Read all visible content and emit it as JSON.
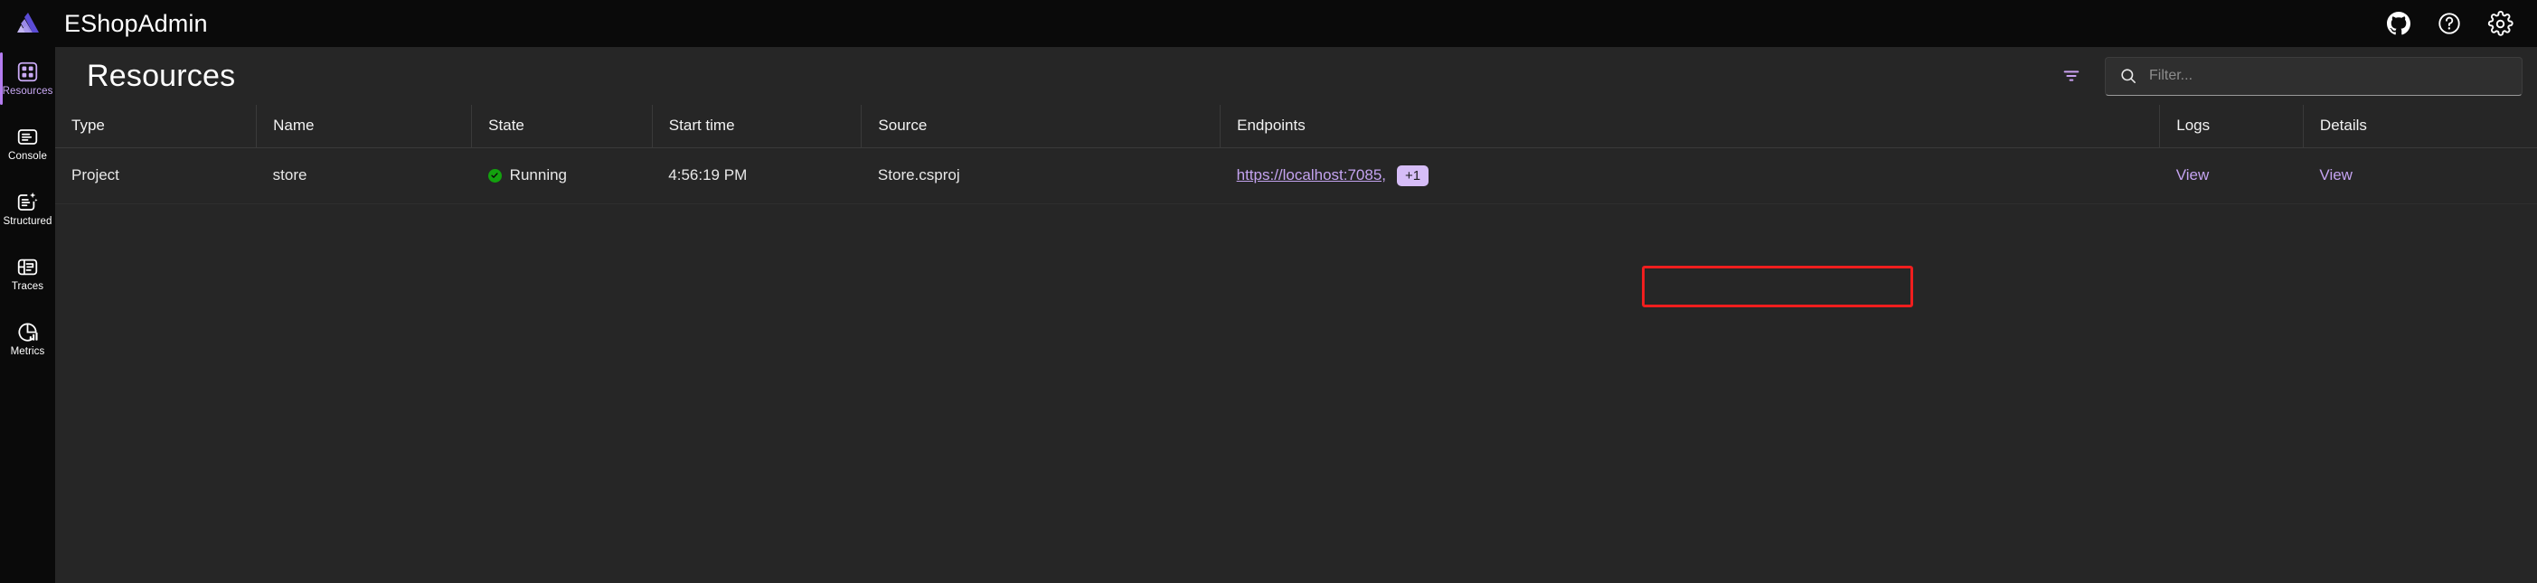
{
  "header": {
    "app_title": "EShopAdmin",
    "logo_icon": "aspire-logo-icon",
    "actions": [
      {
        "name": "github-icon",
        "label": "GitHub"
      },
      {
        "name": "help-icon",
        "label": "Help"
      },
      {
        "name": "settings-gear-icon",
        "label": "Settings"
      }
    ]
  },
  "sidebar": {
    "items": [
      {
        "label": "Resources",
        "icon": "resources-grid-icon",
        "active": true
      },
      {
        "label": "Console",
        "icon": "console-log-icon",
        "active": false
      },
      {
        "label": "Structured",
        "icon": "structured-logs-icon",
        "active": false
      },
      {
        "label": "Traces",
        "icon": "traces-icon",
        "active": false
      },
      {
        "label": "Metrics",
        "icon": "metrics-chart-icon",
        "active": false
      }
    ]
  },
  "page": {
    "title": "Resources",
    "filter_toggle_icon": "filter-icon",
    "search": {
      "icon": "search-icon",
      "placeholder": "Filter...",
      "value": ""
    }
  },
  "table": {
    "columns": [
      "Type",
      "Name",
      "State",
      "Start time",
      "Source",
      "Endpoints",
      "Logs",
      "Details"
    ],
    "rows": [
      {
        "type": "Project",
        "name": "store",
        "state": "Running",
        "state_icon": "checkmark-circle-icon",
        "start_time": "4:56:19 PM",
        "source": "Store.csproj",
        "endpoint_url": "https://localhost:7085,",
        "endpoint_more": "+1",
        "logs": "View",
        "details": "View"
      }
    ]
  },
  "annotation": {
    "color": "#f01e1e",
    "target": "endpoint-url-link"
  },
  "colors": {
    "accent": "#b47cf0",
    "link": "#c4a3f0",
    "running": "#13a10e",
    "badge_bg": "#d6bdf7",
    "header_bg": "#0a0a0a",
    "main_bg": "#262626"
  }
}
